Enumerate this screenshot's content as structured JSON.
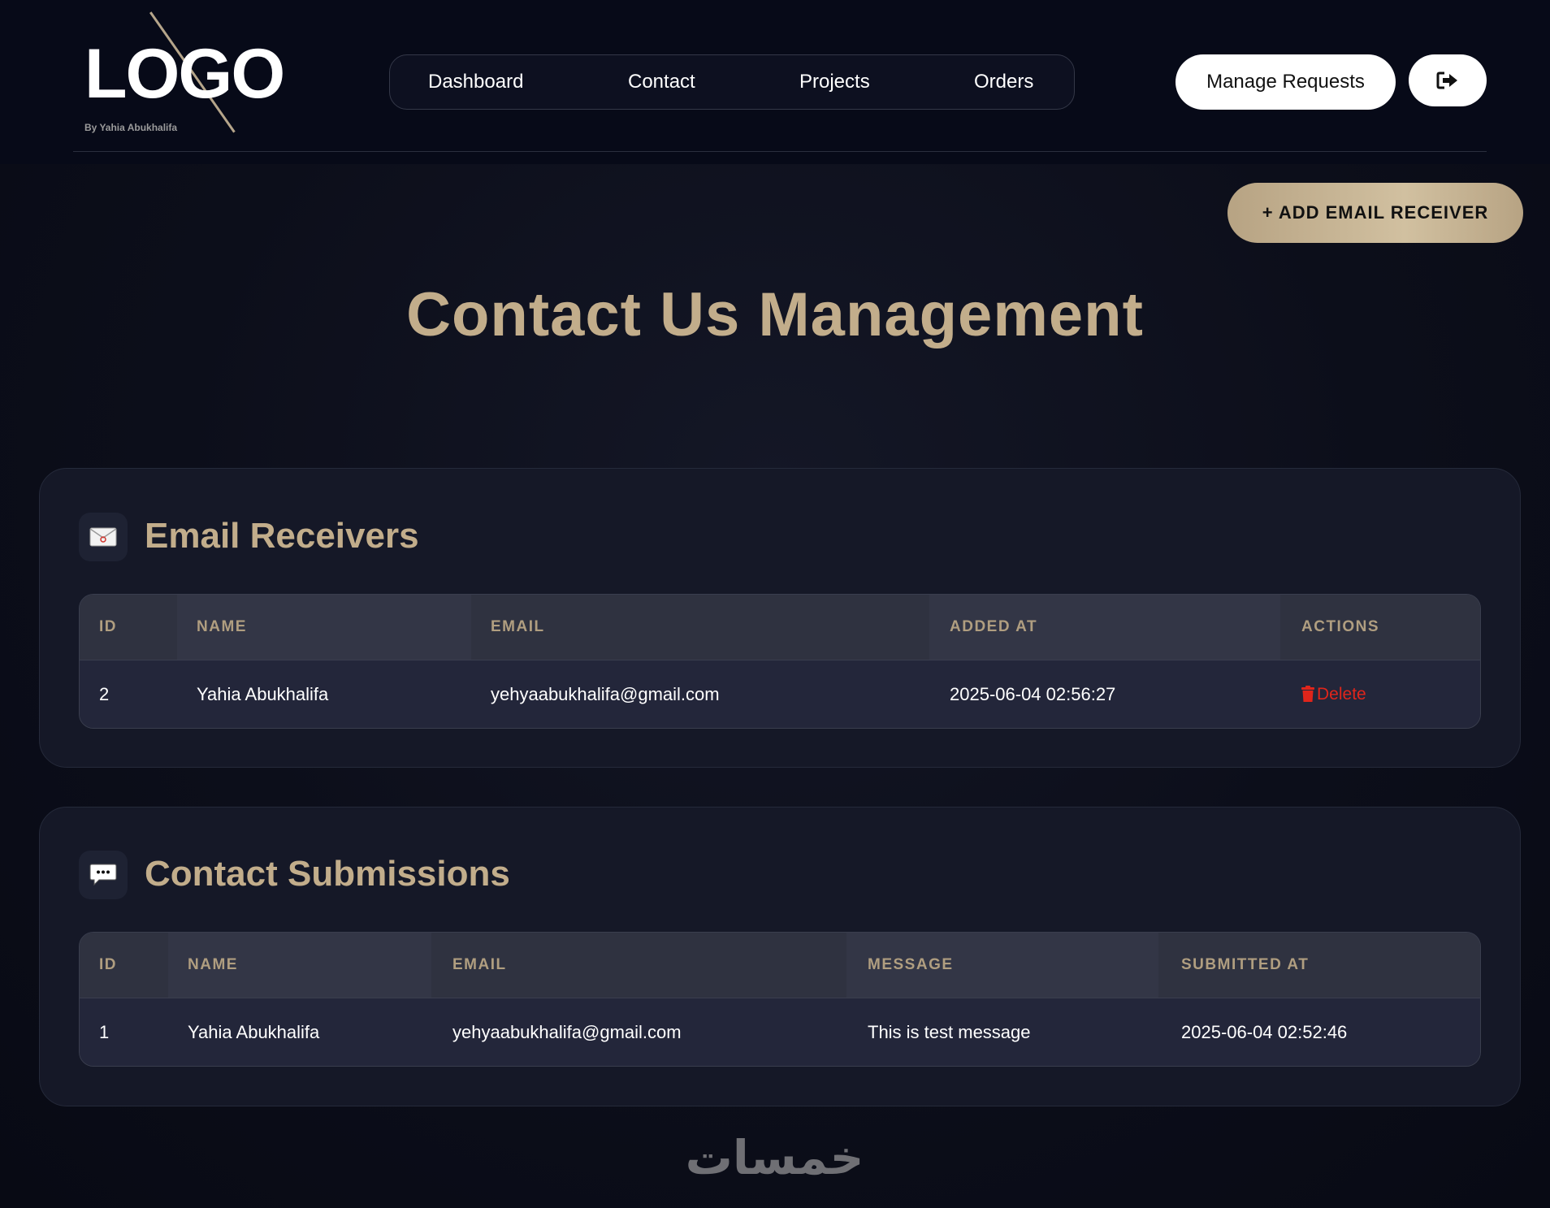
{
  "logo": {
    "text": "LOGO",
    "subtitle": "By Yahia Abukhalifa"
  },
  "nav": {
    "items": [
      "Dashboard",
      "Contact",
      "Projects",
      "Orders"
    ]
  },
  "header": {
    "manage_label": "Manage Requests",
    "logout_icon": "sign-out-icon"
  },
  "actions": {
    "add_receiver_label": "+ ADD EMAIL RECEIVER"
  },
  "page": {
    "title": "Contact Us Management"
  },
  "receivers": {
    "title": "Email Receivers",
    "icon": "envelope-icon",
    "columns": [
      "ID",
      "NAME",
      "EMAIL",
      "ADDED AT",
      "ACTIONS"
    ],
    "rows": [
      {
        "id": "2",
        "name": "Yahia Abukhalifa",
        "email": "yehyaabukhalifa@gmail.com",
        "added_at": "2025-06-04 02:56:27",
        "action": "Delete"
      }
    ]
  },
  "submissions": {
    "title": "Contact Submissions",
    "icon": "chat-bubble-icon",
    "columns": [
      "ID",
      "NAME",
      "EMAIL",
      "MESSAGE",
      "SUBMITTED AT"
    ],
    "rows": [
      {
        "id": "1",
        "name": "Yahia Abukhalifa",
        "email": "yehyaabukhalifa@gmail.com",
        "message": "This is test message",
        "submitted_at": "2025-06-04 02:52:46"
      }
    ]
  },
  "watermark": {
    "text": "خمسات"
  },
  "colors": {
    "accent": "#c2ad8b",
    "delete": "#e0251b",
    "background": "#0c0e1a"
  }
}
